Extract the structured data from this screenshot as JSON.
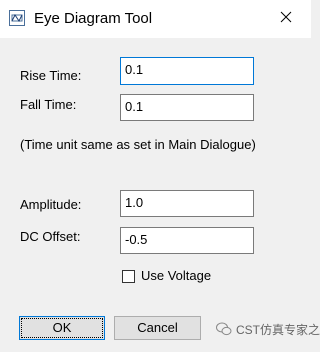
{
  "window": {
    "title": "Eye Diagram Tool",
    "icon": "eye-diagram-app-icon",
    "close_icon": "close-icon"
  },
  "form": {
    "rise_time": {
      "label": "Rise Time:",
      "value": "0.1"
    },
    "fall_time": {
      "label": "Fall Time:",
      "value": "0.1"
    },
    "time_note": "(Time unit same as set in Main Dialogue)",
    "amplitude": {
      "label": "Amplitude:",
      "value": "1.0"
    },
    "dc_offset": {
      "label": "DC Offset:",
      "value": "-0.5"
    },
    "use_voltage": {
      "label": "Use Voltage",
      "checked": false
    }
  },
  "buttons": {
    "ok": "OK",
    "cancel": "Cancel"
  },
  "watermark": {
    "text": "CST仿真专家之路",
    "icon": "wechat-icon"
  },
  "colors": {
    "focus_border": "#0078d7",
    "dialog_bg": "#f0f0f0",
    "titlebar_bg": "#ffffff"
  }
}
